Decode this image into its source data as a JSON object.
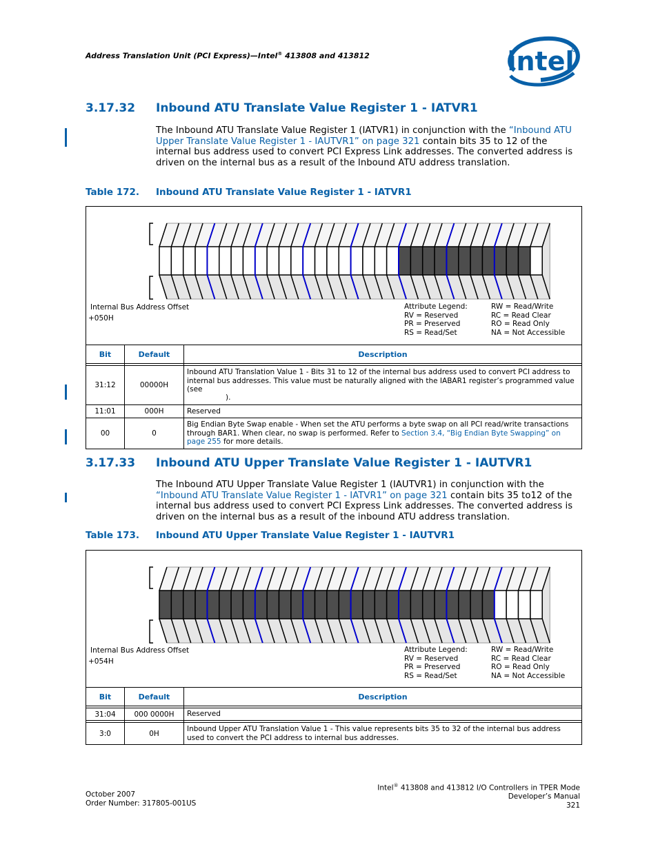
{
  "header": {
    "running_title_a": "Address Translation Unit (PCI Express)—Intel",
    "running_title_reg": "®",
    "running_title_b": " 413808 and 413812",
    "logo_text": "intel"
  },
  "colors": {
    "brand_blue": "#0860a8",
    "dark_cell": "#4d4d4d",
    "nibble_separator": "#0000cc"
  },
  "section1": {
    "number": "3.17.32",
    "title": "Inbound ATU Translate Value Register 1 - IATVR1",
    "para_a": "The Inbound ATU Translate Value Register 1 (IATVR1) in conjunction with the ",
    "para_link": "“Inbound ATU Upper Translate Value Register 1 - IAUTVR1” on page 321",
    "para_b": " contain bits 35 to 12 of the internal bus address used to convert PCI Express Link addresses. The converted address is driven on the internal bus as a result of the Inbound ATU address translation.",
    "table_number": "Table 172.",
    "table_title": "Inbound ATU Translate Value Register 1 - IATVR1",
    "diagram": {
      "offset_label": "Internal Bus Address Offset",
      "offset_value": "+050H",
      "bit_fill": "wwwwwwwwwwwwwwwwwwwwdddddddddddw"
    },
    "columns": [
      "Bit",
      "Default",
      "Description"
    ],
    "rows": [
      {
        "bit": "31:12",
        "default": "00000H",
        "desc": "Inbound ATU Translation Value 1 - Bits 31 to 12 of the internal bus address used to convert PCI address to internal bus addresses. This value must be naturally aligned with the IABAR1 register’s programmed value (see",
        "desc_tail": ")."
      },
      {
        "bit": "11:01",
        "default": "000H",
        "desc": "Reserved"
      },
      {
        "bit": "00",
        "default": "0",
        "desc": "Big Endian Byte Swap enable - When set the ATU performs a byte swap on all PCI read/write transactions through BAR1. When clear, no swap is performed. Refer to ",
        "desc_link": "Section 3.4, “Big Endian Byte Swapping” on page 255",
        "desc_tail": " for more details."
      }
    ]
  },
  "section2": {
    "number": "3.17.33",
    "title": "Inbound ATU Upper Translate Value Register 1 - IAUTVR1",
    "para_a": "The Inbound ATU Upper Translate Value Register 1 (IAUTVR1) in conjunction with the ",
    "para_link": "“Inbound ATU Translate Value Register 1 - IATVR1” on page 321",
    "para_b": " contain bits 35 to12 of the internal bus address used to convert PCI Express Link addresses. The converted address is driven on the internal bus as a result of the inbound ATU address translation.",
    "table_number": "Table 173.",
    "table_title": "Inbound ATU Upper Translate Value Register 1 - IAUTVR1",
    "diagram": {
      "offset_label": "Internal Bus Address Offset",
      "offset_value": "+054H",
      "bit_fill": "ddddddddddddddddddddddddddddwwww"
    },
    "columns": [
      "Bit",
      "Default",
      "Description"
    ],
    "rows": [
      {
        "bit": "31:04",
        "default": "000 0000H",
        "desc": "Reserved"
      },
      {
        "bit": "3:0",
        "default": "0H",
        "desc": "Inbound Upper ATU Translation Value 1 - This value represents bits 35 to 32 of the internal bus address used to convert the PCI address to internal bus addresses."
      }
    ]
  },
  "legend": {
    "title": "Attribute Legend:",
    "left": [
      "RV = Reserved",
      "PR = Preserved",
      "RS = Read/Set"
    ],
    "right": [
      "RW = Read/Write",
      "RC = Read Clear",
      "RO = Read Only",
      "NA = Not Accessible"
    ]
  },
  "footer": {
    "date": "October 2007",
    "order_number": "Order Number: 317805-001US",
    "doc_title_a": "Intel",
    "doc_title_reg": "®",
    "doc_title_b": " 413808 and 413812 I/O Controllers in TPER Mode",
    "doc_subtitle": "Developer’s Manual",
    "page": "321"
  }
}
